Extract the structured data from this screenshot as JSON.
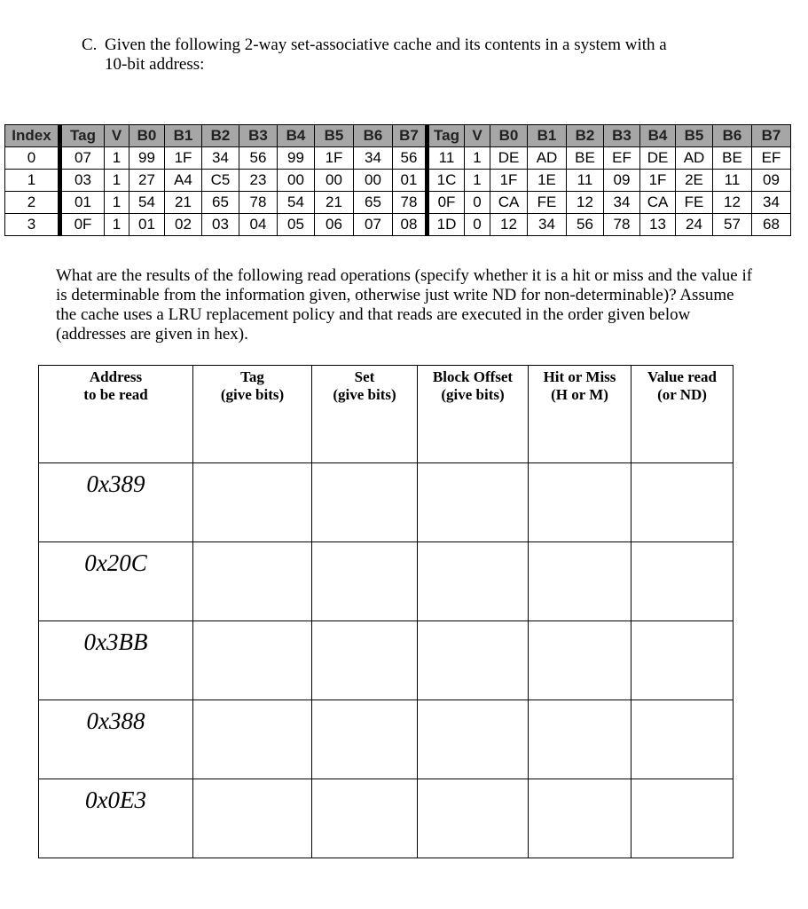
{
  "intro": {
    "label": "C.",
    "line1": "Given the following 2-way set-associative cache and its contents in a system with a",
    "line2": "10-bit address:"
  },
  "cache_table": {
    "headers": [
      "Index",
      "Tag",
      "V",
      "B0",
      "B1",
      "B2",
      "B3",
      "B4",
      "B5",
      "B6",
      "B7",
      "Tag",
      "V",
      "B0",
      "B1",
      "B2",
      "B3",
      "B4",
      "B5",
      "B6",
      "B7"
    ],
    "rows": [
      {
        "index": "0",
        "way0": {
          "tag": "07",
          "v": "1",
          "bytes": [
            "99",
            "1F",
            "34",
            "56",
            "99",
            "1F",
            "34",
            "56"
          ]
        },
        "way1": {
          "tag": "11",
          "v": "1",
          "bytes": [
            "DE",
            "AD",
            "BE",
            "EF",
            "DE",
            "AD",
            "BE",
            "EF"
          ]
        }
      },
      {
        "index": "1",
        "way0": {
          "tag": "03",
          "v": "1",
          "bytes": [
            "27",
            "A4",
            "C5",
            "23",
            "00",
            "00",
            "00",
            "01"
          ]
        },
        "way1": {
          "tag": "1C",
          "v": "1",
          "bytes": [
            "1F",
            "1E",
            "11",
            "09",
            "1F",
            "2E",
            "11",
            "09"
          ]
        }
      },
      {
        "index": "2",
        "way0": {
          "tag": "01",
          "v": "1",
          "bytes": [
            "54",
            "21",
            "65",
            "78",
            "54",
            "21",
            "65",
            "78"
          ]
        },
        "way1": {
          "tag": "0F",
          "v": "0",
          "bytes": [
            "CA",
            "FE",
            "12",
            "34",
            "CA",
            "FE",
            "12",
            "34"
          ]
        }
      },
      {
        "index": "3",
        "way0": {
          "tag": "0F",
          "v": "1",
          "bytes": [
            "01",
            "02",
            "03",
            "04",
            "05",
            "06",
            "07",
            "08"
          ]
        },
        "way1": {
          "tag": "1D",
          "v": "0",
          "bytes": [
            "12",
            "34",
            "56",
            "78",
            "13",
            "24",
            "57",
            "68"
          ]
        }
      }
    ]
  },
  "question": "What are the results of the following read operations (specify whether it is a hit or miss and the value if is determinable from the information given, otherwise just write ND for non-determinable)?  Assume the cache uses a LRU replacement policy and that reads are executed in the order given below (addresses are given in hex).",
  "answer_table": {
    "headers": [
      {
        "line1": "Address",
        "line2": "to be read"
      },
      {
        "line1": "Tag",
        "line2": "(give bits)"
      },
      {
        "line1": "Set",
        "line2": "(give bits)"
      },
      {
        "line1": "Block Offset",
        "line2": "(give bits)"
      },
      {
        "line1": "Hit or Miss",
        "line2": "(H or M)"
      },
      {
        "line1": "Value read",
        "line2": "(or ND)"
      }
    ],
    "rows": [
      {
        "address": "0x389",
        "tag": "",
        "set": "",
        "offset": "",
        "hit_miss": "",
        "value": ""
      },
      {
        "address": "0x20C",
        "tag": "",
        "set": "",
        "offset": "",
        "hit_miss": "",
        "value": ""
      },
      {
        "address": "0x3BB",
        "tag": "",
        "set": "",
        "offset": "",
        "hit_miss": "",
        "value": ""
      },
      {
        "address": "0x388",
        "tag": "",
        "set": "",
        "offset": "",
        "hit_miss": "",
        "value": ""
      },
      {
        "address": "0x0E3",
        "tag": "",
        "set": "",
        "offset": "",
        "hit_miss": "",
        "value": ""
      }
    ]
  }
}
